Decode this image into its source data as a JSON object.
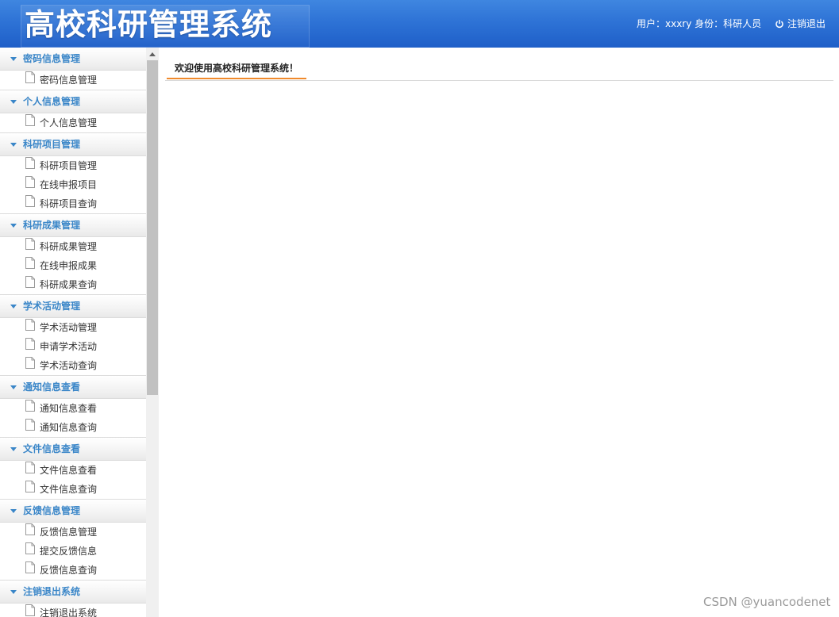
{
  "header": {
    "title": "高校科研管理系统",
    "user_info": "用户：xxxry 身份：科研人员",
    "logout_label": "注销退出"
  },
  "sidebar": {
    "groups": [
      {
        "title": "密码信息管理",
        "items": [
          "密码信息管理"
        ]
      },
      {
        "title": "个人信息管理",
        "items": [
          "个人信息管理"
        ]
      },
      {
        "title": "科研项目管理",
        "items": [
          "科研项目管理",
          "在线申报项目",
          "科研项目查询"
        ]
      },
      {
        "title": "科研成果管理",
        "items": [
          "科研成果管理",
          "在线申报成果",
          "科研成果查询"
        ]
      },
      {
        "title": "学术活动管理",
        "items": [
          "学术活动管理",
          "申请学术活动",
          "学术活动查询"
        ]
      },
      {
        "title": "通知信息查看",
        "items": [
          "通知信息查看",
          "通知信息查询"
        ]
      },
      {
        "title": "文件信息查看",
        "items": [
          "文件信息查看",
          "文件信息查询"
        ]
      },
      {
        "title": "反馈信息管理",
        "items": [
          "反馈信息管理",
          "提交反馈信息",
          "反馈信息查询"
        ]
      },
      {
        "title": "注销退出系统",
        "items": [
          "注销退出系统"
        ]
      }
    ]
  },
  "main": {
    "tab_label": "欢迎使用高校科研管理系统！"
  },
  "watermark": "CSDN @yuancodenet",
  "colors": {
    "header_blue": "#2e73d6",
    "group_title": "#3a86c8",
    "tab_underline": "#f08a2c"
  },
  "icons": {
    "logout": "power-icon",
    "group_caret": "caret-down-icon",
    "item": "document-icon"
  }
}
